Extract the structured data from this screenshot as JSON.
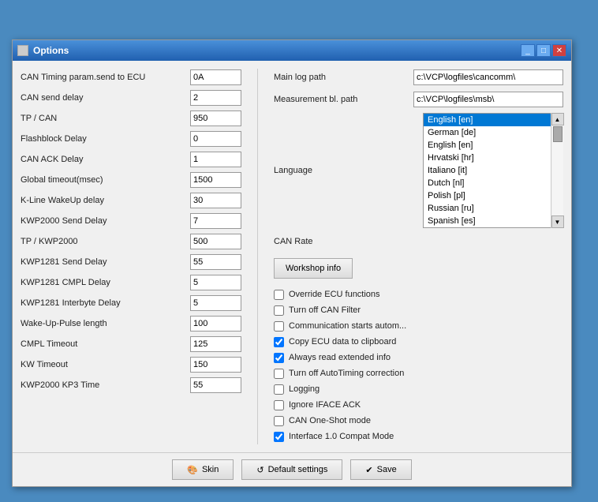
{
  "window": {
    "title": "Options",
    "icon": "□"
  },
  "title_buttons": {
    "minimize": "_",
    "maximize": "□",
    "close": "✕"
  },
  "left_panel": {
    "fields": [
      {
        "label": "CAN Timing param.send to ECU",
        "value": "0A"
      },
      {
        "label": "CAN send delay",
        "value": "2"
      },
      {
        "label": "TP / CAN",
        "value": "950"
      },
      {
        "label": "Flashblock Delay",
        "value": "0"
      },
      {
        "label": "CAN ACK Delay",
        "value": "1"
      },
      {
        "label": "Global timeout(msec)",
        "value": "1500"
      },
      {
        "label": "K-Line WakeUp delay",
        "value": "30"
      },
      {
        "label": "KWP2000 Send Delay",
        "value": "7"
      },
      {
        "label": "TP / KWP2000",
        "value": "500"
      },
      {
        "label": "KWP1281 Send Delay",
        "value": "55"
      },
      {
        "label": "KWP1281 CMPL Delay",
        "value": "5"
      },
      {
        "label": "KWP1281 Interbyte Delay",
        "value": "5"
      },
      {
        "label": "Wake-Up-Pulse length",
        "value": "100"
      },
      {
        "label": "CMPL Timeout",
        "value": "125"
      },
      {
        "label": "KW Timeout",
        "value": "150"
      },
      {
        "label": "KWP2000 KP3 Time",
        "value": "55"
      }
    ]
  },
  "right_panel": {
    "main_log_path_label": "Main log path",
    "main_log_path_value": "c:\\VCP\\logfiles\\cancomm\\",
    "measurement_path_label": "Measurement bl. path",
    "measurement_path_value": "c:\\VCP\\logfiles\\msb\\",
    "language_label": "Language",
    "language_selected": "English [en]",
    "language_options": [
      "German [de]",
      "English [en]",
      "Hrvatski [hr]",
      "Italiano [it]",
      "Dutch [nl]",
      "Polish [pl]",
      "Russian [ru]",
      "Spanish [es]"
    ],
    "can_rate_label": "CAN Rate",
    "workshop_btn_label": "Workshop info",
    "checkboxes": [
      {
        "label": "Override ECU functions",
        "checked": false
      },
      {
        "label": "Turn off CAN Filter",
        "checked": false
      },
      {
        "label": "Communication starts autom...",
        "checked": false
      },
      {
        "label": "Copy ECU data to clipboard",
        "checked": true
      },
      {
        "label": "Always read extended info",
        "checked": true
      },
      {
        "label": "Turn off AutoTiming correction",
        "checked": false
      },
      {
        "label": "Logging",
        "checked": false
      },
      {
        "label": "Ignore IFACE ACK",
        "checked": false
      },
      {
        "label": "CAN One-Shot mode",
        "checked": false
      },
      {
        "label": "Interface 1.0 Compat Mode",
        "checked": true
      }
    ]
  },
  "bottom_bar": {
    "skin_label": "Skin",
    "default_settings_label": "Default settings",
    "save_label": "Save"
  },
  "colors": {
    "accent": "#0078d4",
    "title_gradient_start": "#4a90d9",
    "title_gradient_end": "#2060b0"
  }
}
